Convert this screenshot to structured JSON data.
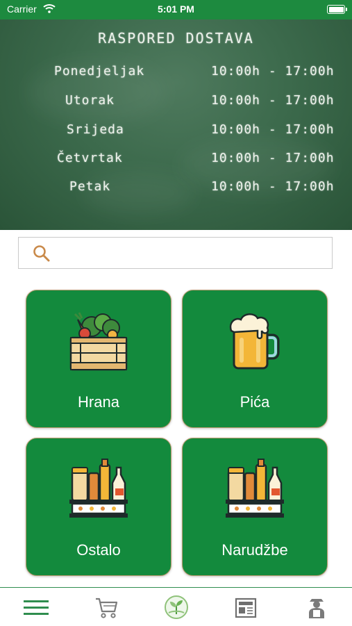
{
  "status_bar": {
    "carrier": "Carrier",
    "time": "5:01 PM"
  },
  "schedule": {
    "title": "RASPORED DOSTAVA",
    "days": [
      {
        "day": "Ponedjeljak",
        "hours": "10:00h - 17:00h"
      },
      {
        "day": "Utorak",
        "hours": "10:00h - 17:00h"
      },
      {
        "day": "Srijeda",
        "hours": "10:00h - 17:00h"
      },
      {
        "day": "Četvrtak",
        "hours": "10:00h - 17:00h"
      },
      {
        "day": "Petak",
        "hours": "10:00h - 17:00h"
      }
    ]
  },
  "search": {
    "value": "",
    "placeholder": ""
  },
  "categories": [
    {
      "label": "Hrana",
      "icon": "vegetable-crate-icon"
    },
    {
      "label": "Pića",
      "icon": "beer-mug-icon"
    },
    {
      "label": "Ostalo",
      "icon": "groceries-shelf-icon"
    },
    {
      "label": "Narudžbe",
      "icon": "groceries-shelf-icon"
    }
  ],
  "bottom_nav": [
    {
      "name": "menu",
      "icon": "hamburger-menu-icon"
    },
    {
      "name": "cart",
      "icon": "shopping-cart-icon"
    },
    {
      "name": "home",
      "icon": "sprout-icon"
    },
    {
      "name": "news",
      "icon": "newspaper-icon"
    },
    {
      "name": "profile",
      "icon": "farmer-icon"
    }
  ],
  "colors": {
    "brand_green": "#138a3d",
    "status_green": "#1d8a3f",
    "chalkboard": "#3c6a4c",
    "tile_border": "#b89a6c"
  }
}
